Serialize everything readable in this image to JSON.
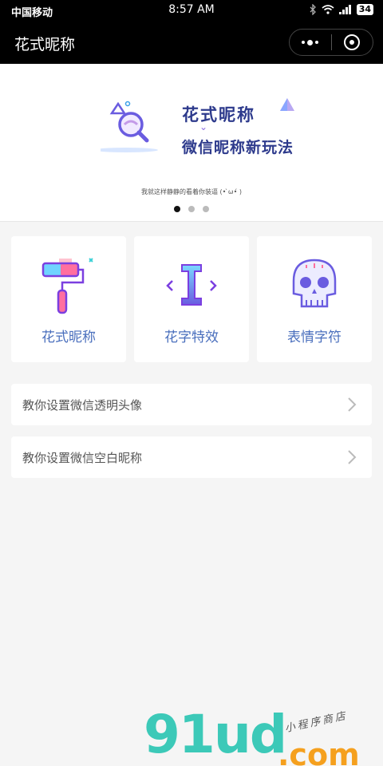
{
  "status_bar": {
    "carrier": "中国移动",
    "time": "8:57 AM",
    "battery": "34"
  },
  "nav": {
    "title": "花式昵称"
  },
  "banner": {
    "line1": "花式昵称",
    "line2": "微信昵称新玩法",
    "caption": "我就这样静静的看着你装逼 (• ̀ω•́ )",
    "slides": 3,
    "active_slide": 0
  },
  "features": [
    {
      "label": "花式昵称",
      "icon": "paint-roller-icon"
    },
    {
      "label": "花字特效",
      "icon": "text-cursor-icon"
    },
    {
      "label": "表情字符",
      "icon": "skull-icon"
    }
  ],
  "rows": [
    {
      "label": "教你设置微信透明头像"
    },
    {
      "label": "教你设置微信空白昵称"
    }
  ],
  "watermark": {
    "brand": "91ud",
    "suffix": ".com",
    "shop": "小程序商店"
  },
  "colors": {
    "accent_blue": "#4a6fbd",
    "brand_teal": "#3cc9b8",
    "watermark_orange": "#f5a01e"
  }
}
